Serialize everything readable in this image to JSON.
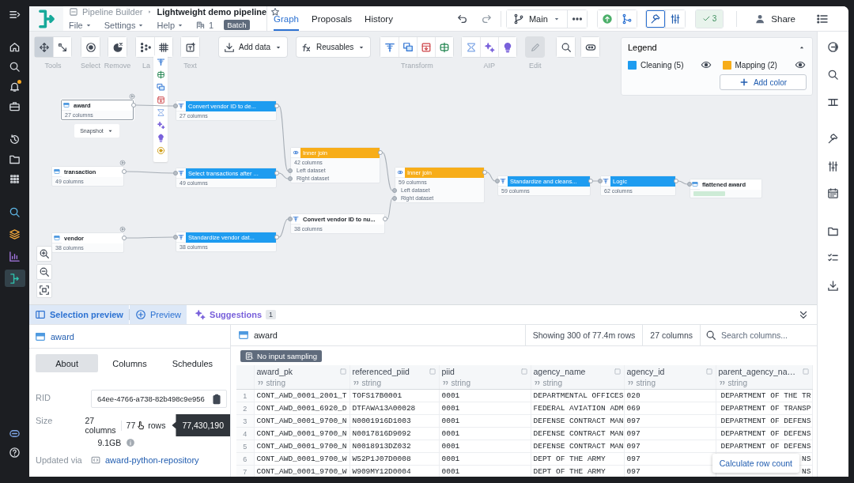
{
  "header": {
    "breadcrumb": "Pipeline Builder",
    "title": "Lightweight demo pipeline",
    "starred": false,
    "menus": [
      "File",
      "Settings",
      "Help"
    ],
    "builds": "1",
    "mode": "Batch",
    "tabs": [
      {
        "label": "Graph",
        "selected": true
      },
      {
        "label": "Proposals",
        "selected": false
      },
      {
        "label": "History",
        "selected": false
      }
    ],
    "branch": "Main",
    "checks": "3",
    "share": "Share"
  },
  "toolbar": {
    "tools": [
      {
        "selected": true
      },
      {
        "selected": false
      }
    ],
    "groups": [
      {
        "label": "Tools",
        "disabled": false
      },
      {
        "label": "Select",
        "disabled": false
      },
      {
        "label": "Remove",
        "disabled": false
      },
      {
        "label": "La",
        "disabled": false
      },
      {
        "label": "Text",
        "disabled": false
      },
      {
        "label": "Transform",
        "disabled": false
      },
      {
        "label": "AIP",
        "disabled": false
      },
      {
        "label": "Edit",
        "disabled": true
      }
    ],
    "add_data": "Add data",
    "reusables": "Reusables"
  },
  "legend": {
    "title": "Legend",
    "expanded": true,
    "items": [
      {
        "label": "Cleaning (5)",
        "color": "#1e9cf0",
        "visible": true
      },
      {
        "label": "Mapping (2)",
        "color": "#f7ad19",
        "visible": true
      }
    ],
    "add": "Add color"
  },
  "graph": {
    "snapshot": "Snapshot",
    "nodes": [
      {
        "kind": "dataset",
        "title": "award",
        "subtitle": "27 columns",
        "selected": true
      },
      {
        "kind": "transform",
        "title": "Convert vendor ID to de...",
        "subtitle": "27 columns",
        "color": "#1e9cf0",
        "selected": false
      },
      {
        "kind": "dataset",
        "title": "transaction",
        "subtitle": "49 columns",
        "selected": false
      },
      {
        "kind": "transform",
        "title": "Select transactions after ...",
        "subtitle": "49 columns",
        "color": "#1e9cf0",
        "selected": false
      },
      {
        "kind": "dataset",
        "title": "vendor",
        "subtitle": "38 columns",
        "selected": false
      },
      {
        "kind": "transform",
        "title": "Standardize vendor dat...",
        "subtitle": "38 columns",
        "color": "#1e9cf0",
        "selected": false
      },
      {
        "kind": "join",
        "title": "Inner join",
        "subtitle": "42 columns",
        "color": "#f7ad19",
        "inputs": [
          "Left dataset",
          "Right dataset"
        ],
        "selected": false
      },
      {
        "kind": "transform",
        "title": "Convert vendor ID to nu...",
        "subtitle": "38 columns",
        "selected": false
      },
      {
        "kind": "join",
        "title": "Inner join",
        "subtitle": "59 columns",
        "color": "#f7ad19",
        "inputs": [
          "Left dataset",
          "Right dataset"
        ],
        "selected": false
      },
      {
        "kind": "transform",
        "title": "Standardize and cleans...",
        "subtitle": "59 columns",
        "color": "#1e9cf0",
        "selected": false
      },
      {
        "kind": "transform",
        "title": "Logic",
        "subtitle": "62 columns",
        "color": "#1e9cf0",
        "selected": false
      },
      {
        "kind": "output",
        "title": "flattened award",
        "selected": false
      }
    ]
  },
  "bottom": {
    "tabs": [
      {
        "label": "Selection preview",
        "selected": true
      },
      {
        "label": "Preview",
        "selected": false
      },
      {
        "label": "Suggestions",
        "selected": false,
        "badge": "1"
      }
    ]
  },
  "details": {
    "title": "award",
    "tabs": [
      {
        "label": "About",
        "selected": true
      },
      {
        "label": "Columns",
        "selected": false
      },
      {
        "label": "Schedules",
        "selected": false
      }
    ],
    "rid_label": "RID",
    "rid": "64ee-4766-a738-82b498c9e956",
    "size_label": "Size",
    "columns": "27 columns",
    "rows_shown": "77",
    "rows_unit": "rows",
    "bytes": "9.1GB",
    "tooltip": "77,430,190",
    "updated_label": "Updated via",
    "updated_link": "award-python-repository"
  },
  "table": {
    "title": "award",
    "summary": "Showing 300 of 77.4m rows",
    "columns_count": "27 columns",
    "search_placeholder": "Search columns...",
    "sampling": "No input sampling",
    "columns": [
      {
        "name": "award_pk",
        "type": "string"
      },
      {
        "name": "referenced_piid",
        "type": "string"
      },
      {
        "name": "piid",
        "type": "string"
      },
      {
        "name": "agency_name",
        "type": "string"
      },
      {
        "name": "agency_id",
        "type": "string"
      },
      {
        "name": "parent_agency_na…",
        "type": "string"
      }
    ],
    "rows": [
      {
        "number": "1",
        "cells": [
          "CONT_AWD_0001_2001_T",
          "TOFS17B0001",
          "0001",
          "DEPARTMENTAL OFFICES",
          "020",
          "DEPARTMENT OF THE TR"
        ]
      },
      {
        "number": "2",
        "cells": [
          "CONT_AWD_0001_6920_D",
          "DTFAWA13A00028",
          "0001",
          "FEDERAL AVIATION ADM",
          "069",
          "DEPARTMENT OF TRANSP"
        ]
      },
      {
        "number": "3",
        "cells": [
          "CONT_AWD_0001_9700_N",
          "N0001916D1003",
          "0001",
          "DEFENSE CONTRACT MAN",
          "097",
          "DEPARTMENT OF DEFENS"
        ]
      },
      {
        "number": "4",
        "cells": [
          "CONT_AWD_0001_9700_N",
          "N0017816D9092",
          "0001",
          "DEFENSE CONTRACT MAN",
          "097",
          "DEPARTMENT OF DEFENS"
        ]
      },
      {
        "number": "5",
        "cells": [
          "CONT_AWD_0001_9700_N",
          "N0018913DZ032",
          "0001",
          "DEFENSE CONTRACT MAN",
          "097",
          "DEPARTMENT OF DEFENS"
        ]
      },
      {
        "number": "6",
        "cells": [
          "CONT_AWD_0001_9700_W",
          "W52P1J07D0008",
          "0001",
          "DEPT OF THE ARMY",
          "097",
          "NS"
        ]
      },
      {
        "number": "7",
        "cells": [
          "CONT_AWD_0001_9700_W",
          "W909MY12D0004",
          "0001",
          "DEPT OF THE ARMY",
          "097",
          "NS"
        ]
      }
    ],
    "action": "Calculate row count"
  }
}
